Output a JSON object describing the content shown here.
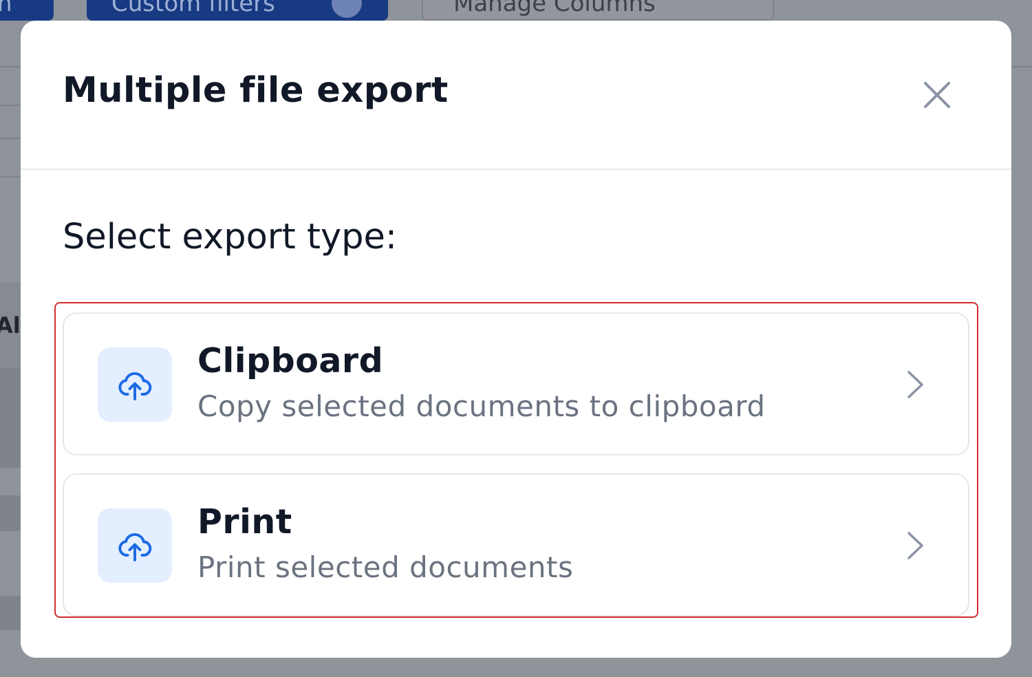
{
  "background": {
    "buttons": [
      {
        "label": "n"
      },
      {
        "label": "Custom filters"
      },
      {
        "label": "Manage Columns"
      }
    ],
    "table_stub_text": "Al"
  },
  "modal": {
    "title": "Multiple file export",
    "close_icon": "close-icon",
    "section_label": "Select export type:",
    "options": [
      {
        "title": "Clipboard",
        "description": "Copy selected documents to clipboard",
        "icon": "cloud-upload-icon",
        "chevron_icon": "chevron-right-icon"
      },
      {
        "title": "Print",
        "description": "Print selected documents",
        "icon": "cloud-upload-icon",
        "chevron_icon": "chevron-right-icon"
      }
    ]
  },
  "colors": {
    "accent": "#1d6ae5",
    "icon_tile_bg": "#e3efff",
    "highlight_border": "#d22c2c",
    "title_text": "#111827",
    "secondary_text": "#6b7280",
    "overlay": "#8f939a"
  }
}
